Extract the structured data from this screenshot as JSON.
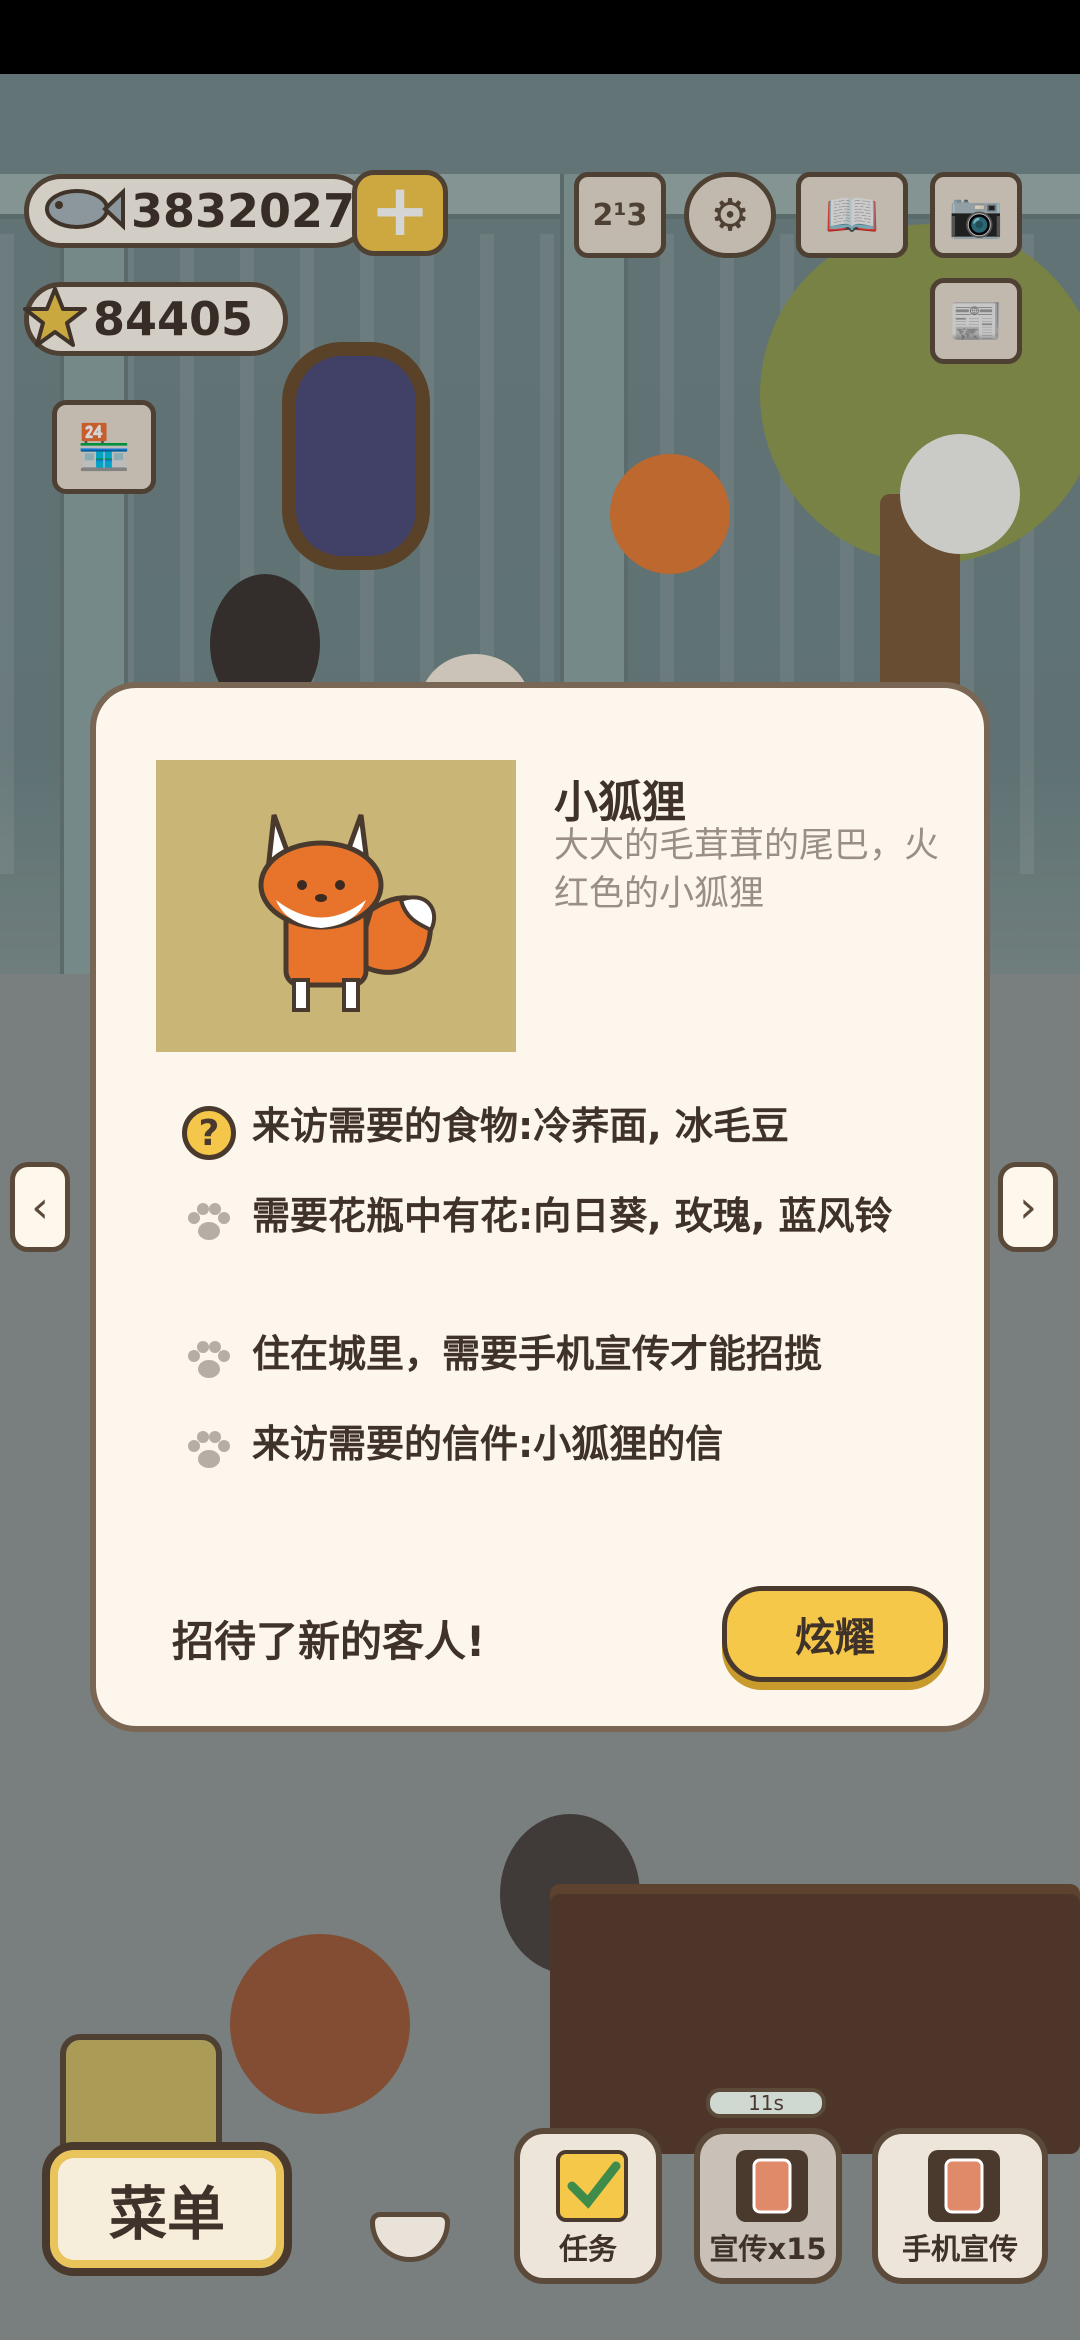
{
  "hud": {
    "fish_count": "3832027",
    "star_count": "84405",
    "icons": [
      "fish-icon",
      "plus-icon",
      "star-icon",
      "ranking-icon",
      "gear-icon",
      "book-icon",
      "camera-icon",
      "newspaper-icon",
      "shop-icon"
    ]
  },
  "dialog": {
    "guest_name": "小狐狸",
    "guest_desc": "大大的毛茸茸的尾巴，火红色的小狐狸",
    "requirements": [
      {
        "icon": "question-icon",
        "text": "来访需要的食物:冷荞面, 冰毛豆"
      },
      {
        "icon": "paw-icon",
        "text": "需要花瓶中有花:向日葵, 玫瑰, 蓝风铃"
      },
      {
        "icon": "paw-icon",
        "text": "住在城里，需要手机宣传才能招揽"
      },
      {
        "icon": "paw-icon",
        "text": "来访需要的信件:小狐狸的信"
      }
    ],
    "welcome_text": "招待了新的客人!",
    "show_off_label": "炫耀"
  },
  "bottom_bar": {
    "menu_label": "菜单",
    "tasks_label": "任务",
    "promo_label": "宣传x15",
    "phone_promo_label": "手机宣传",
    "timer_text": "11s"
  },
  "colors": {
    "accent_yellow": "#f6c84a",
    "outline_brown": "#4a3a2e",
    "dialog_bg": "#fcf6ec",
    "portrait_bg": "#c9b676",
    "fox_orange": "#e8742c"
  }
}
